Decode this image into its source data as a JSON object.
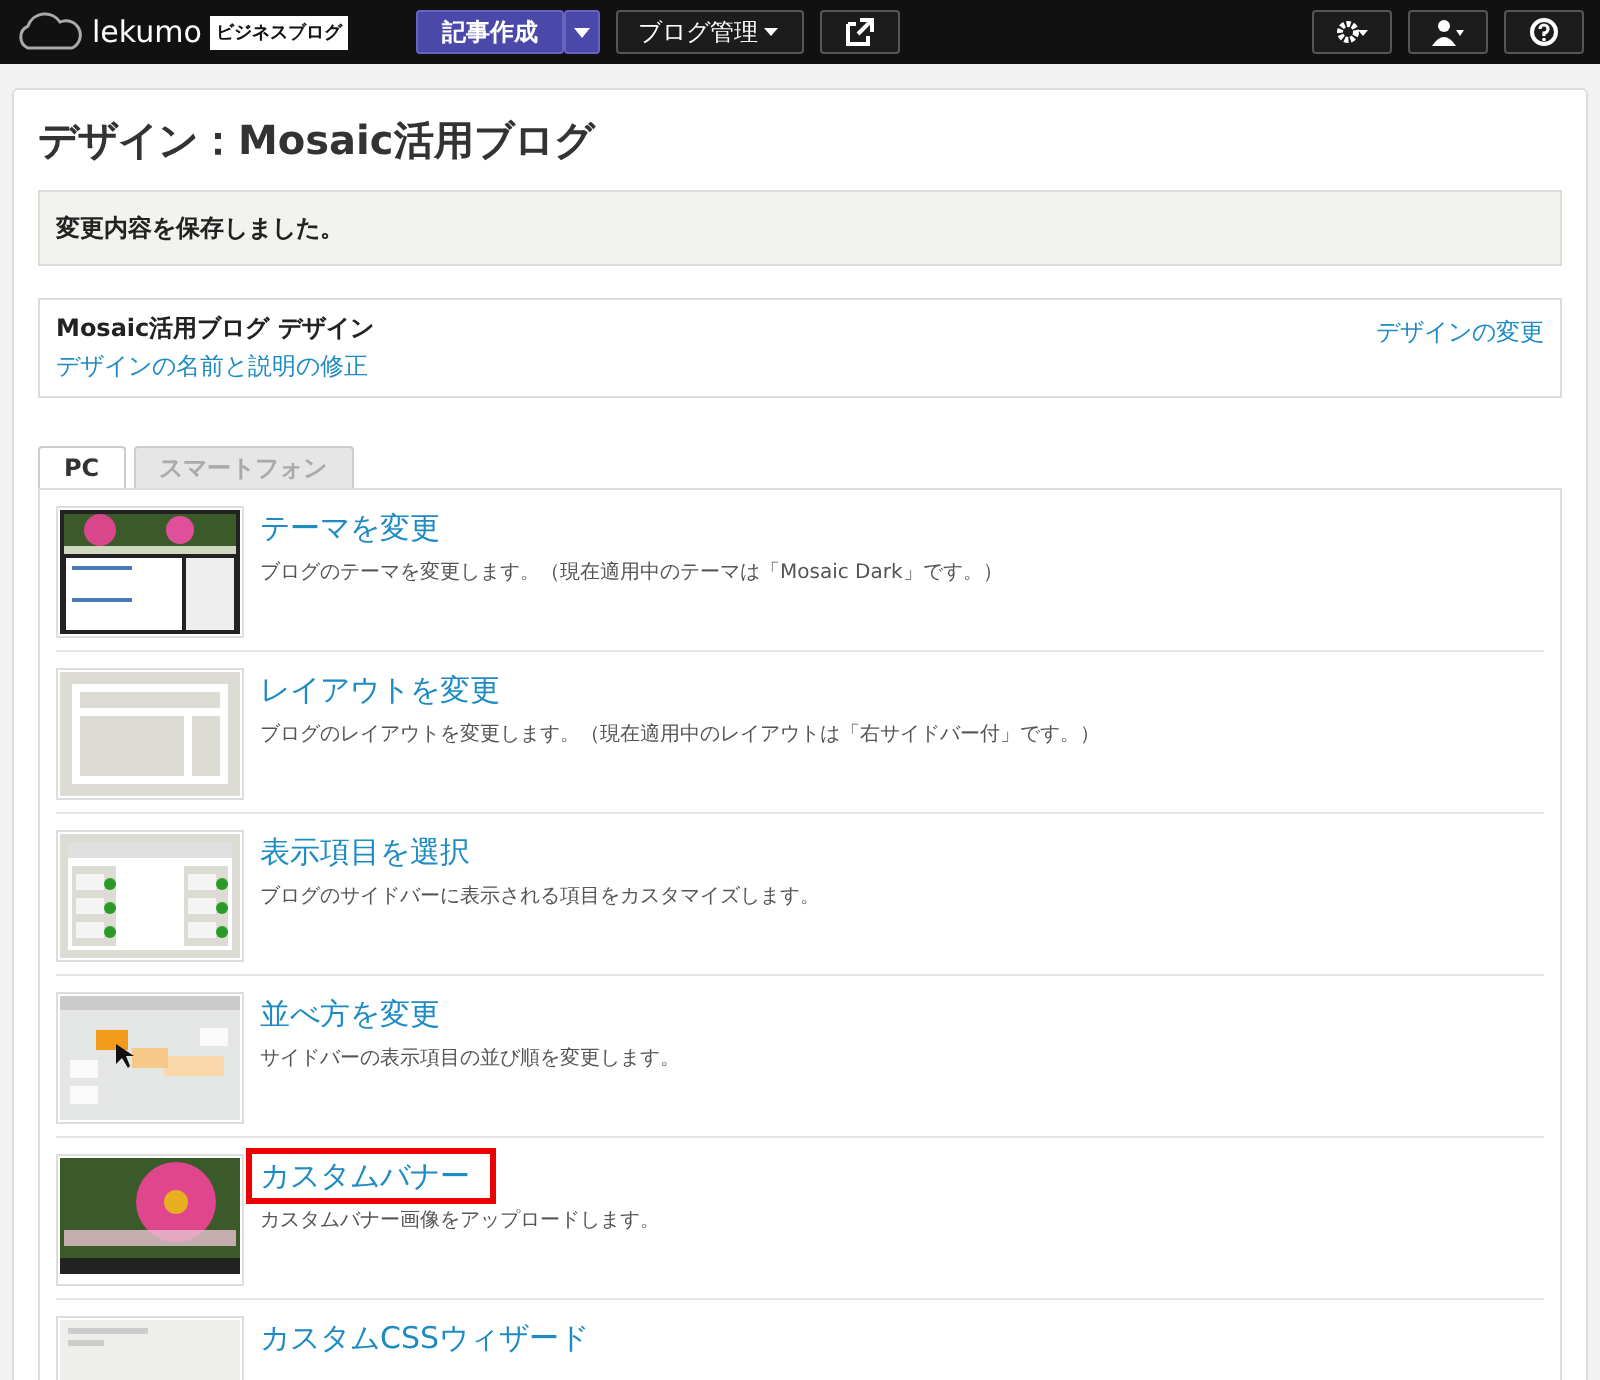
{
  "topbar": {
    "logo": "lekumo",
    "logo_badge": "ビジネスブログ",
    "new_post": "記事作成",
    "blog_menu": "ブログ管理"
  },
  "title": "デザイン：Mosaic活用ブログ",
  "message": "変更内容を保存しました。",
  "design_box": {
    "name": "Mosaic活用ブログ デザイン",
    "edit_link": "デザインの名前と説明の修正",
    "change_link": "デザインの変更"
  },
  "tabs": [
    {
      "label": "PC",
      "selected": true
    },
    {
      "label": "スマートフォン",
      "selected": false
    }
  ],
  "items": [
    {
      "kind": "theme",
      "title": "テーマを変更",
      "description": "ブログのテーマを変更します。（現在適用中のテーマは「Mosaic Dark」です。）",
      "highlighted": false
    },
    {
      "kind": "layout",
      "title": "レイアウトを変更",
      "description": "ブログのレイアウトを変更します。（現在適用中のレイアウトは「右サイドバー付」です。）",
      "highlighted": false
    },
    {
      "kind": "select",
      "title": "表示項目を選択",
      "description": "ブログのサイドバーに表示される項目をカスタマイズします。",
      "highlighted": false
    },
    {
      "kind": "order",
      "title": "並べ方を変更",
      "description": "サイドバーの表示項目の並び順を変更します。",
      "highlighted": false
    },
    {
      "kind": "banner",
      "title": "カスタムバナー",
      "description": "カスタムバナー画像をアップロードします。",
      "highlighted": true
    },
    {
      "kind": "css",
      "title": "カスタムCSSウィザード",
      "highlighted": false
    }
  ]
}
